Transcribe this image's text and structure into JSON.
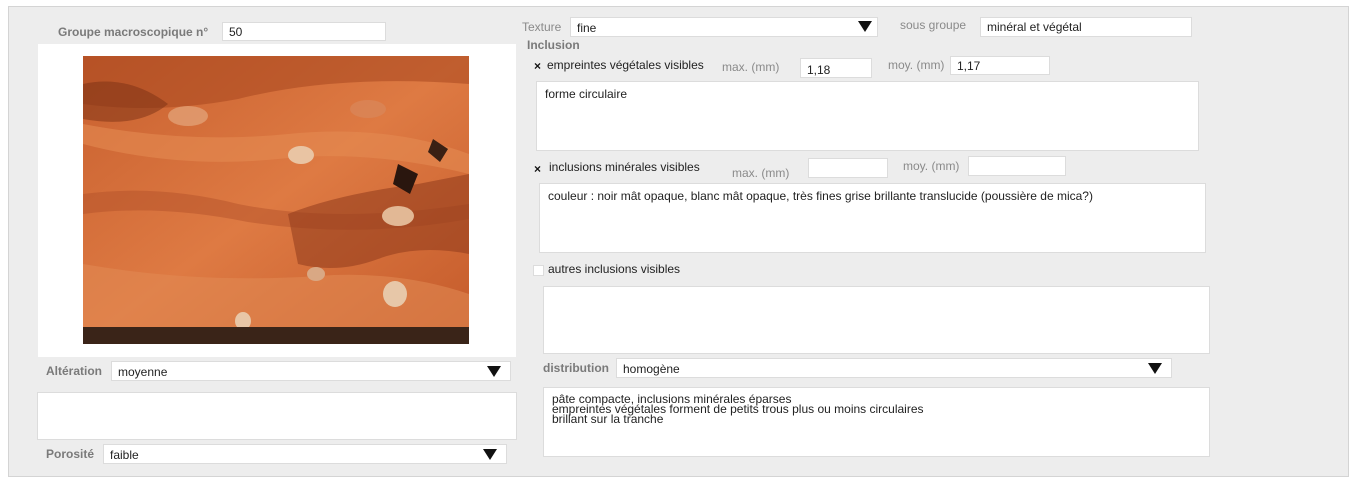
{
  "left": {
    "groupe_label": "Groupe macroscopique n°",
    "groupe_value": "50",
    "alteration_label": "Altération",
    "alteration_value": "moyenne",
    "alteration_notes": "",
    "porosite_label": "Porosité",
    "porosite_value": "faible"
  },
  "texture": {
    "label": "Texture",
    "value": "fine",
    "sous_groupe_label": "sous groupe",
    "sous_groupe_value": "minéral et végétal"
  },
  "inclusion": {
    "heading": "Inclusion",
    "vegetal": {
      "checked": true,
      "check_mark": "×",
      "label": "empreintes végétales visibles",
      "max_label": "max. (mm)",
      "max_value": "1,18",
      "moy_label": "moy. (mm)",
      "moy_value": "1,17",
      "notes": "forme circulaire"
    },
    "mineral": {
      "checked": true,
      "check_mark": "×",
      "label": "inclusions minérales visibles",
      "max_label": "max. (mm)",
      "max_value": "",
      "moy_label": "moy. (mm)",
      "moy_value": "",
      "notes": "couleur : noir mât opaque, blanc mât opaque, très fines grise brillante translucide (poussière de mica?)"
    },
    "autres": {
      "checked": false,
      "label": "autres inclusions visibles",
      "notes": ""
    }
  },
  "distribution": {
    "label": "distribution",
    "value": "homogène",
    "notes": "pâte compacte, inclusions minérales éparses\nempreintes végétales forment de petits trous plus ou moins circulaires\nbrillant sur la tranche"
  },
  "colors": {
    "panel_bg": "#ededed",
    "field_bg": "#ffffff",
    "label_gray": "#8a8a8a",
    "ceramic_orange": "#d9713a",
    "ceramic_dark": "#3a2418"
  }
}
